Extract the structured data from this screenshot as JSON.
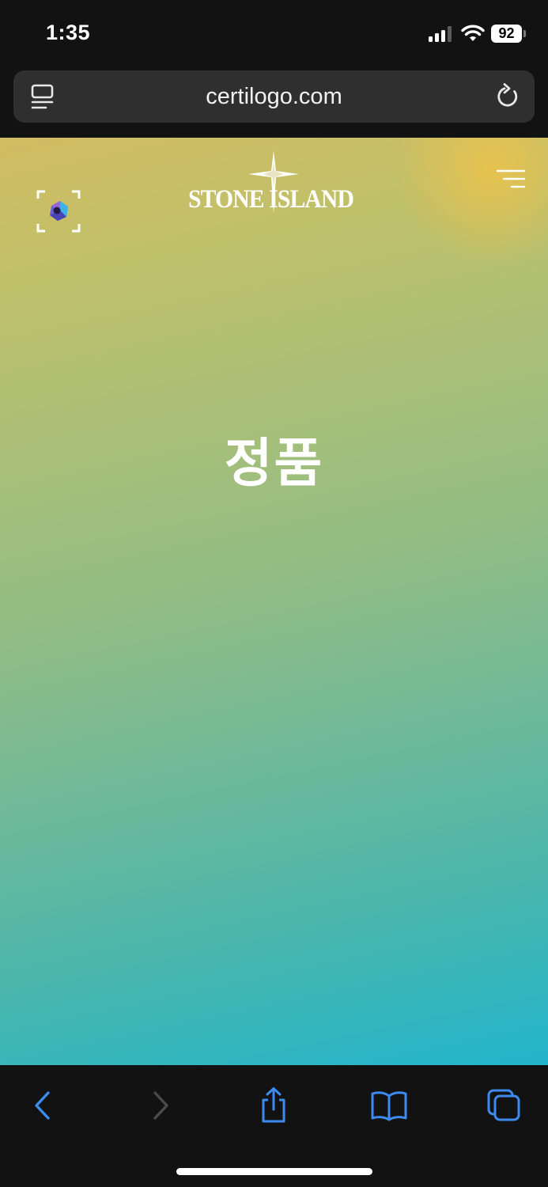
{
  "status_bar": {
    "time": "1:35",
    "battery_level": "92"
  },
  "url_bar": {
    "domain": "certilogo.com"
  },
  "page": {
    "brand": {
      "word_left": "STONE",
      "word_right": "ISLAND"
    },
    "headline": "정품",
    "gradient_colors": [
      "#d2bd62",
      "#a5bf7a",
      "#6db99a",
      "#22b5cc"
    ]
  },
  "toolbar": {
    "accent_color": "#3d8bf0",
    "disabled_color": "#4a4a4a",
    "icons": [
      "back-icon",
      "forward-icon",
      "share-icon",
      "bookmarks-icon",
      "tabs-icon"
    ]
  }
}
